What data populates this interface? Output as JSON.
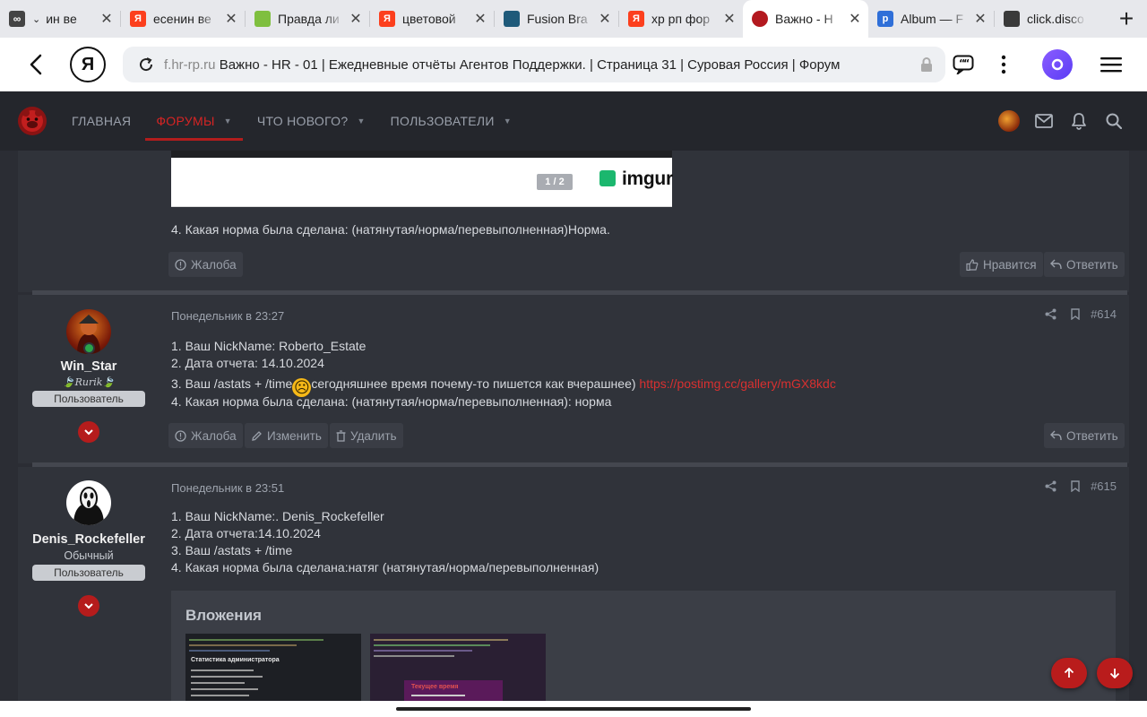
{
  "browser": {
    "tabs": [
      {
        "title": "ин ве",
        "favicon": "infinity-icon",
        "color": "#444444"
      },
      {
        "title": "есенин ве",
        "favicon": "yandex-icon",
        "color": "#fc3f1d"
      },
      {
        "title": "Правда ли",
        "favicon": "site-icon",
        "color": "#7fbf3f"
      },
      {
        "title": "цветовой",
        "favicon": "yandex-icon",
        "color": "#fc3f1d"
      },
      {
        "title": "Fusion Bra",
        "favicon": "site-icon",
        "color": "#1f5a7a"
      },
      {
        "title": "хр рп фор",
        "favicon": "yandex-icon",
        "color": "#fc3f1d"
      },
      {
        "title": "Важно - Н",
        "favicon": "forum-icon",
        "color": "#b3191f"
      },
      {
        "title": "Album — F",
        "favicon": "postimg-icon",
        "color": "#2f6fd8"
      },
      {
        "title": "click.disco",
        "favicon": "site-icon",
        "color": "#3a3a3a"
      }
    ],
    "address": {
      "host": "f.hr-rp.ru",
      "title": "Важно - HR - 01 | Ежедневные отчёты Агентов Поддержки. | Страница 31 | Суровая Россия | Форум"
    }
  },
  "forum_nav": {
    "items": [
      {
        "label": "ГЛАВНАЯ",
        "dropdown": false,
        "active": false
      },
      {
        "label": "ФОРУМЫ",
        "dropdown": true,
        "active": true
      },
      {
        "label": "ЧТО НОВОГО?",
        "dropdown": true,
        "active": false
      },
      {
        "label": "ПОЛЬЗОВАТЕЛИ",
        "dropdown": true,
        "active": false
      }
    ]
  },
  "post_prev": {
    "image_counter": "1 / 2",
    "image_host": "imgur",
    "line4": "4. Какая норма была сделана: (натянутая/норма/перевыполненная)Норма.",
    "report_label": "Жалоба",
    "like_label": "Нравится",
    "reply_label": "Ответить"
  },
  "post_614": {
    "date": "Понедельник в 23:27",
    "number": "#614",
    "user": {
      "name": "Win_Star",
      "title": "Rurik",
      "badge": "Пользователь"
    },
    "line1": "1. Ваш NickName: Roberto_Estate",
    "line2": "2. Дата отчета: 14.10.2024",
    "line3_before": "3. Ваш /astats + /time",
    "line3_emoji": "☹",
    "line3_after": "сегодняшнее время почему-то пишется как вчерашнее) ",
    "line3_link": "https://postimg.cc/gallery/mGX8kdc",
    "line4": "4. Какая норма была сделана: (натянутая/норма/перевыполненная): норма",
    "report_label": "Жалоба",
    "edit_label": "Изменить",
    "delete_label": "Удалить",
    "reply_label": "Ответить"
  },
  "post_615": {
    "date": "Понедельник в 23:51",
    "number": "#615",
    "user": {
      "name": "Denis_Rockefeller",
      "title": "Обычный",
      "badge": "Пользователь"
    },
    "line1": "1. Ваш NickName:. Denis_Rockefeller",
    "line2": "2. Дата отчета:14.10.2024",
    "line3": "3. Ваш /astats + /time",
    "line4": "4. Какая норма была сделана:натяг (натянутая/норма/перевыполненная)",
    "attachments_title": "Вложения",
    "thumb1_heading": "Статистика администратора",
    "thumb2_heading": "Текущее время"
  }
}
